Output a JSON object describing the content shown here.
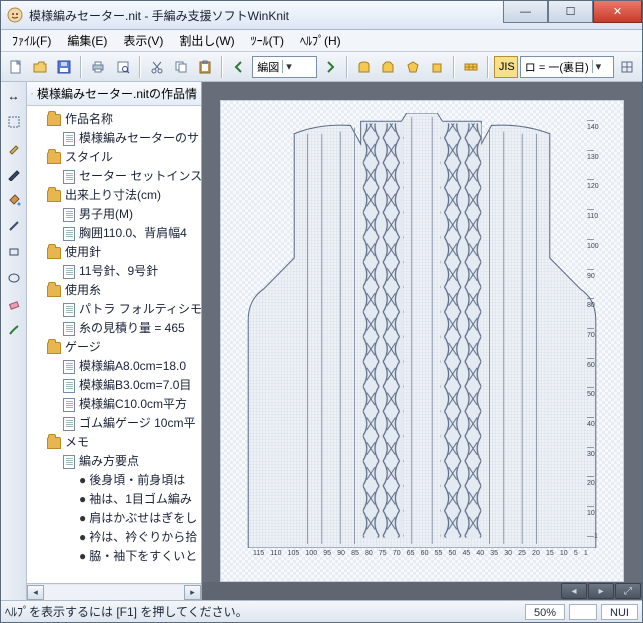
{
  "window": {
    "title": "模様編みセーター.nit - 手編み支援ソフトWinKnit"
  },
  "menu": {
    "file": "ﾌｧｲﾙ(F)",
    "edit": "編集(E)",
    "view": "表示(V)",
    "split": "割出し(W)",
    "tool": "ﾂｰﾙ(T)",
    "help": "ﾍﾙﾌﾟ(H)"
  },
  "toolbar": {
    "mode": "編図",
    "jis": "JIS",
    "stitch": "ロ = 一(裏目)"
  },
  "panel": {
    "head": "模様編みセーター.nitの作品情",
    "tree": [
      {
        "t": "folder",
        "l": 1,
        "label": "作品名称"
      },
      {
        "t": "doc",
        "l": 2,
        "label": "模様編みセーターのサン"
      },
      {
        "t": "folder",
        "l": 1,
        "label": "スタイル"
      },
      {
        "t": "doc",
        "l": 2,
        "label": "セーター セットインスリーブ"
      },
      {
        "t": "folder",
        "l": 1,
        "label": "出来上り寸法(cm)"
      },
      {
        "t": "doc",
        "l": 2,
        "label": "男子用(M)"
      },
      {
        "t": "doc",
        "l": 2,
        "label": "胸囲110.0、背肩幅4"
      },
      {
        "t": "folder",
        "l": 1,
        "label": "使用針"
      },
      {
        "t": "doc",
        "l": 2,
        "label": "11号針、9号針"
      },
      {
        "t": "folder",
        "l": 1,
        "label": "使用糸"
      },
      {
        "t": "doc",
        "l": 2,
        "label": "パトラ フォルティシモ太("
      },
      {
        "t": "doc",
        "l": 2,
        "label": "糸の見積り量 = 465"
      },
      {
        "t": "folder",
        "l": 1,
        "label": "ゲージ"
      },
      {
        "t": "doc",
        "l": 2,
        "label": "模様編A8.0cm=18.0"
      },
      {
        "t": "doc",
        "l": 2,
        "label": "模様編B3.0cm=7.0目"
      },
      {
        "t": "doc",
        "l": 2,
        "label": "模様編C10.0cm平方"
      },
      {
        "t": "doc",
        "l": 2,
        "label": "ゴム編ゲージ 10cm平"
      },
      {
        "t": "folder",
        "l": 1,
        "label": "メモ"
      },
      {
        "t": "doc",
        "l": 2,
        "label": "編み方要点"
      },
      {
        "t": "bul",
        "l": 3,
        "label": "後身頃・前身頃は"
      },
      {
        "t": "bul",
        "l": 3,
        "label": "袖は、1目ゴム編み"
      },
      {
        "t": "bul",
        "l": 3,
        "label": "肩はかぶせはぎをし"
      },
      {
        "t": "bul",
        "l": 3,
        "label": "衿は、衿ぐりから拾"
      },
      {
        "t": "bul",
        "l": 3,
        "label": "脇・袖下をすくいと"
      }
    ]
  },
  "ruler_bottom": [
    "1",
    "5",
    "10",
    "15",
    "20",
    "25",
    "30",
    "35",
    "40",
    "45",
    "50",
    "55",
    "60",
    "65",
    "70",
    "75",
    "80",
    "85",
    "90",
    "95",
    "100",
    "105",
    "110",
    "115"
  ],
  "ruler_right": [
    "140",
    "130",
    "120",
    "110",
    "100",
    "90",
    "80",
    "70",
    "60",
    "50",
    "40",
    "30",
    "20",
    "10",
    "1"
  ],
  "status": {
    "msg": "ﾍﾙﾌﾟを表示するには [F1] を押してください。",
    "zoom": "50%",
    "mode": "NUI"
  }
}
